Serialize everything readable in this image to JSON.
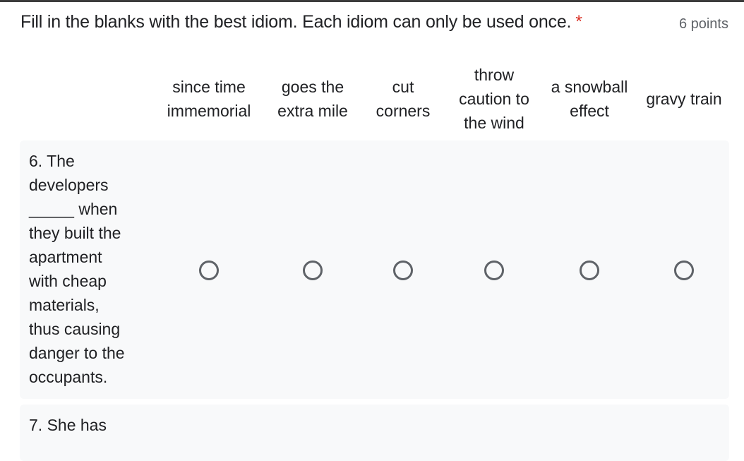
{
  "question": {
    "title": "Fill in the blanks with the best idiom. Each idiom can only be used once.",
    "required_marker": "*",
    "points": "6 points"
  },
  "columns": [
    {
      "lines": [
        "since time",
        "immemorial"
      ]
    },
    {
      "lines": [
        "goes the",
        "extra mile"
      ]
    },
    {
      "lines": [
        "cut",
        "corners"
      ]
    },
    {
      "lines": [
        "throw",
        "caution to",
        "the wind"
      ]
    },
    {
      "lines": [
        "a snowball",
        "effect"
      ]
    },
    {
      "lines": [
        "gravy train"
      ]
    }
  ],
  "rows": [
    {
      "lines": [
        "6. The",
        "developers",
        "_____ when",
        "they built the",
        "apartment",
        "with cheap",
        "materials,",
        "thus causing",
        "danger to the",
        "occupants."
      ],
      "selected": null
    },
    {
      "lines": [
        "7. She has"
      ],
      "selected": null
    }
  ]
}
